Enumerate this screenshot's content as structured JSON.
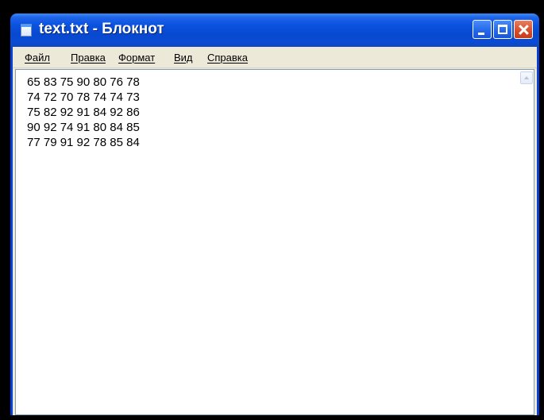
{
  "window": {
    "title": "text.txt - Блокнот",
    "icon": "notepad-icon"
  },
  "titlebar_buttons": {
    "minimize": "minimize-icon",
    "maximize": "maximize-icon",
    "close": "close-icon"
  },
  "menu": {
    "items": [
      {
        "label": "Файл"
      },
      {
        "label": "Правка"
      },
      {
        "label": "Формат"
      },
      {
        "label": "Вид"
      },
      {
        "label": "Справка"
      }
    ]
  },
  "document": {
    "lines": [
      "65 83 75 90 80 76 78",
      "74 72 70 78 74 74 73",
      "75 82 92 91 84 92 86",
      "90 92 74 91 80 84 85",
      "77 79 91 92 78 85 84"
    ]
  },
  "colors": {
    "titlebar": "#0a52e0",
    "close_button": "#d6502c",
    "menubar": "#ece9d8",
    "editor_background": "#ffffff"
  }
}
